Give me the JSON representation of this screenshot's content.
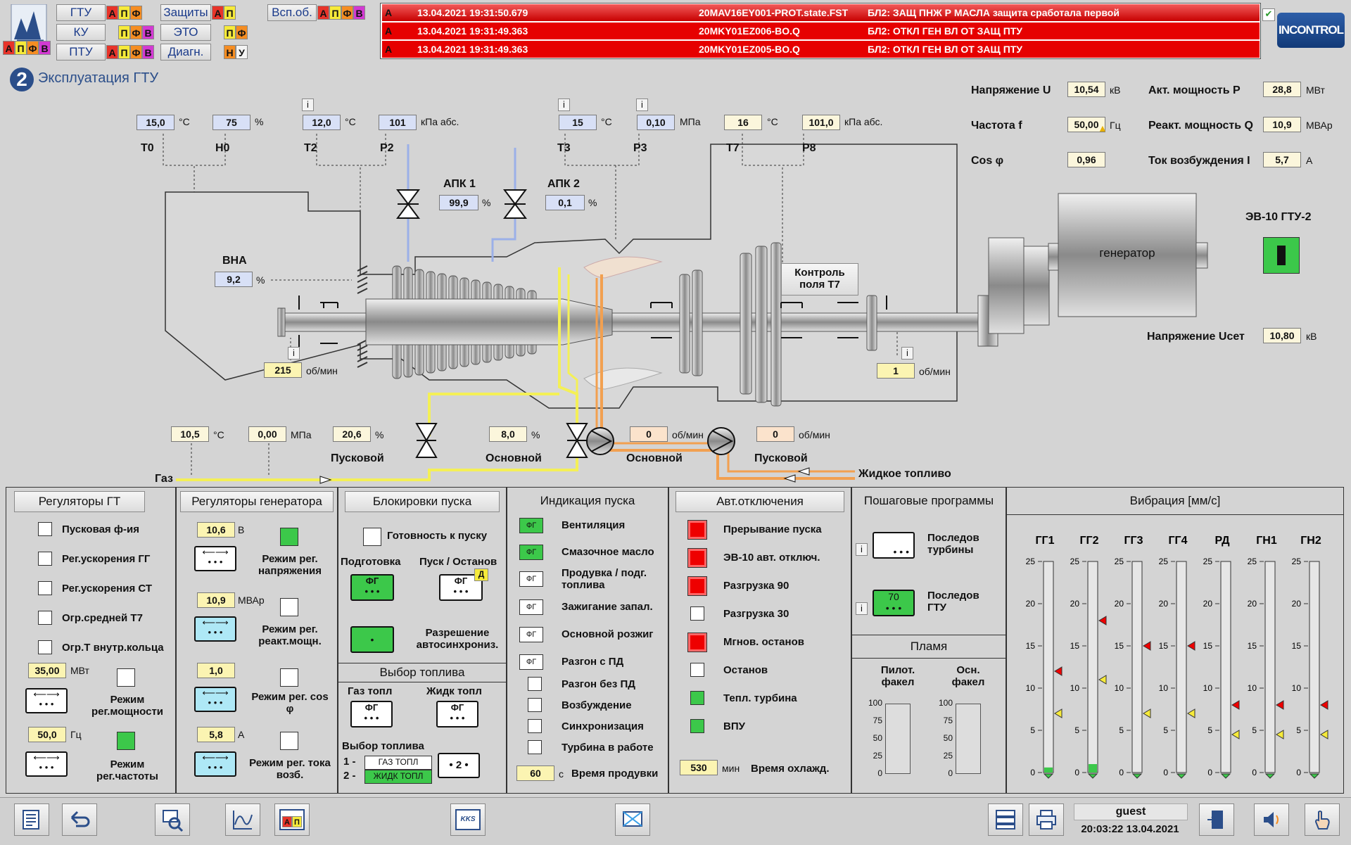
{
  "nav": {
    "gtu": "ГТУ",
    "ku": "КУ",
    "ptu": "ПТУ",
    "zashchity": "Защиты",
    "eto": "ЭТО",
    "diagn": "Диагн.",
    "vspob": "Всп.об.",
    "ind_a": "А",
    "ind_p": "П",
    "ind_f": "Ф",
    "ind_v": "В",
    "ind_n": "Н",
    "ind_u": "У"
  },
  "alarms": [
    {
      "sev": "A",
      "time": "13.04.2021 19:31:50.679",
      "tag": "20MAV16EY001-PROT.state.FST",
      "text": "БЛ2: ЗАЩ ПНЖ Р МАСЛА защита сработала первой"
    },
    {
      "sev": "A",
      "time": "13.04.2021 19:31:49.363",
      "tag": "20MKY01EZ006-BO.Q",
      "text": "БЛ2: ОТКЛ ГЕН ВЛ ОТ ЗАЩ ПТУ"
    },
    {
      "sev": "A",
      "time": "13.04.2021 19:31:49.363",
      "tag": "20MKY01EZ005-BO.Q",
      "text": "БЛ2: ОТКЛ ГЕН ВЛ ОТ ЗАЩ ПТУ"
    }
  ],
  "brand": "INCONTROL",
  "page": {
    "number": "2",
    "title": "Эксплуатация ГТУ"
  },
  "params": {
    "T0": {
      "label": "T0",
      "value": "15,0",
      "unit": "°C"
    },
    "H0": {
      "label": "H0",
      "value": "75",
      "unit": "%"
    },
    "T2": {
      "label": "T2",
      "value": "12,0",
      "unit": "°C"
    },
    "P2": {
      "label": "P2",
      "value": "101",
      "unit": "кПа абс."
    },
    "T3": {
      "label": "T3",
      "value": "15",
      "unit": "°C"
    },
    "P3": {
      "label": "P3",
      "value": "0,10",
      "unit": "МПа"
    },
    "T7": {
      "label": "T7",
      "value": "16",
      "unit": "°C"
    },
    "P8": {
      "label": "P8",
      "value": "101,0",
      "unit": "кПа абс."
    },
    "apk1": {
      "label": "АПК 1",
      "value": "99,9",
      "unit": "%"
    },
    "apk2": {
      "label": "АПК 2",
      "value": "0,1",
      "unit": "%"
    },
    "vna": {
      "label": "ВНА",
      "value": "9,2",
      "unit": "%"
    },
    "rpm_gg": {
      "value": "215",
      "unit": "об/мин"
    },
    "rpm_st": {
      "value": "1",
      "unit": "об/мин"
    },
    "gas_t": {
      "value": "10,5",
      "unit": "°C"
    },
    "gas_p": {
      "value": "0,00",
      "unit": "МПа"
    },
    "pusk_valve": {
      "label": "Пусковой",
      "value": "20,6",
      "unit": "%"
    },
    "main_valve": {
      "label": "Основной",
      "value": "8,0",
      "unit": "%"
    },
    "main_pump": {
      "label": "Основной",
      "value": "0",
      "unit": "об/мин"
    },
    "pusk_pump": {
      "label": "Пусковой",
      "value": "0",
      "unit": "об/мин"
    },
    "gas_label": "Газ",
    "liquid_label": "Жидкое  топливо",
    "control_t7": "Контроль поля Т7",
    "generator": "генератор"
  },
  "electric": {
    "U": {
      "label": "Напряжение U",
      "value": "10,54",
      "unit": "кВ"
    },
    "f": {
      "label": "Частота f",
      "value": "50,00",
      "unit": "Гц"
    },
    "cos": {
      "label": "Cos φ",
      "value": "0,96"
    },
    "P": {
      "label": "Акт. мощность P",
      "value": "28,8",
      "unit": "МВт"
    },
    "Q": {
      "label": "Реакт. мощность Q",
      "value": "10,9",
      "unit": "МВАр"
    },
    "I": {
      "label": "Ток возбуждения I",
      "value": "5,7",
      "unit": "А"
    },
    "ev10": "ЭВ-10 ГТУ-2",
    "Uset": {
      "label": "Напряжение Uсет",
      "value": "10,80",
      "unit": "кВ"
    }
  },
  "reg_gt": {
    "title": "Регуляторы ГТ",
    "items": [
      "Пусковая ф-ия",
      "Рег.ускорения ГГ",
      "Рег.ускорения СТ",
      "Огр.средней Т7",
      "Огр.Т внутр.кольца"
    ],
    "power": {
      "value": "35,00",
      "unit": "МВт",
      "label": "Режим рег.мощности"
    },
    "freq": {
      "value": "50,0",
      "unit": "Гц",
      "label": "Режим рег.частоты"
    }
  },
  "reg_gen": {
    "title": "Регуляторы генератора",
    "voltage": {
      "value": "10,6",
      "unit": "В",
      "label": "Режим рег. напряжения"
    },
    "reactive": {
      "value": "10,9",
      "unit": "МВАр",
      "label": "Режим рег. реакт.мощн."
    },
    "cos": {
      "value": "1,0",
      "label": "Режим рег. cos φ"
    },
    "current": {
      "value": "5,8",
      "unit": "А",
      "label": "Режим рег. тока возб."
    }
  },
  "block": {
    "title": "Блокировки пуска",
    "ready": "Готовность к пуску",
    "prep": "Подготовка",
    "startstop": "Пуск / Останов",
    "fg": "ФГ",
    "d": "Д",
    "sync": "Разрешение автосинхрониз.",
    "fuel_title": "Выбор топлива",
    "gas": "Газ топл",
    "liquid": "Жидк топл",
    "fuel_select": "Выбор топлива",
    "opt1_num": "1 -",
    "opt1": "ГАЗ ТОПЛ",
    "opt2_num": "2 -",
    "opt2": "ЖИДК ТОПЛ",
    "sel_value": "2"
  },
  "ind_start": {
    "title": "Индикация пуска",
    "items": [
      "Вентиляция",
      "Смазочное масло",
      "Продувка / подг. топлива",
      "Зажигание запал.",
      "Основной розжиг",
      "Разгон с ПД",
      "Разгон без ПД",
      "Возбуждение",
      "Синхронизация",
      "Турбина в работе"
    ],
    "purge_time": {
      "value": "60",
      "unit": "с",
      "label": "Время продувки"
    }
  },
  "auto_off": {
    "title": "Авт.отключения",
    "items": [
      "Прерывание пуска",
      "ЭВ-10 авт. отключ.",
      "Разгрузка 90",
      "Разгрузка 30",
      "Мгнов. останов",
      "Останов",
      "Тепл. турбина",
      "ВПУ"
    ],
    "cool_time": {
      "value": "530",
      "unit": "мин",
      "label": "Время охлажд."
    }
  },
  "programs": {
    "title": "Пошаговые программы",
    "p1": "Последов турбины",
    "p2": "Последов ГТУ",
    "p2_value": "70",
    "flame_title": "Пламя",
    "pilot": "Пилот. факел",
    "main": "Осн. факел",
    "flame_scale": [
      "100",
      "75",
      "50",
      "25",
      "0"
    ]
  },
  "vibration": {
    "title": "Вибрация [мм/с]",
    "scale": [
      "25",
      "20",
      "15",
      "10",
      "5",
      "0"
    ],
    "channels": [
      {
        "name": "ГГ1",
        "value": 0.6,
        "red": 12,
        "yellow": 7
      },
      {
        "name": "ГГ2",
        "value": 1.0,
        "red": 18,
        "yellow": 11
      },
      {
        "name": "ГГ3",
        "value": 0,
        "red": 15,
        "yellow": 7
      },
      {
        "name": "ГГ4",
        "value": 0,
        "red": 15,
        "yellow": 7
      },
      {
        "name": "РД",
        "value": 0,
        "red": 8,
        "yellow": 4.5
      },
      {
        "name": "ГН1",
        "value": 0,
        "red": 8,
        "yellow": 4.5
      },
      {
        "name": "ГН2",
        "value": 0,
        "red": 8,
        "yellow": 4.5
      }
    ]
  },
  "footer": {
    "user": "guest",
    "datetime": "20:03:22 13.04.2021",
    "kks": "KKS",
    "ap_a": "А",
    "ap_p": "П"
  },
  "icons": {
    "check": "check-icon"
  }
}
